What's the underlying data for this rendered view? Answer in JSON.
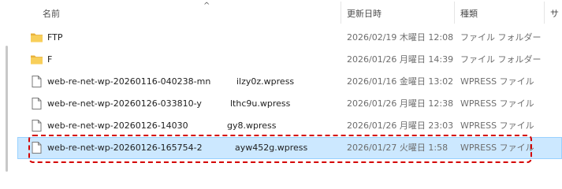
{
  "header": {
    "name_label": "名前",
    "sort_arrow": "^",
    "date_label": "更新日時",
    "type_label": "種類",
    "size_label": "サ"
  },
  "files": [
    {
      "name": "FTP",
      "modified": "2026/02/19 木曜日 12:08",
      "type": "ファイル フォルダー",
      "icon": "folder-icon",
      "selected": false
    },
    {
      "name": "F",
      "name_tail": "",
      "modified": "2026/01/26 月曜日 14:39",
      "type": "ファイル フォルダー",
      "icon": "folder-icon",
      "selected": false
    },
    {
      "name": "web-re-net-wp-20260116-040238-mn",
      "name_tail": "ilzy0z.wpress",
      "modified": "2026/01/16 金曜日 13:02",
      "type": "WPRESS ファイル",
      "icon": "document-icon",
      "selected": false
    },
    {
      "name": "web-re-net-wp-20260126-033810-y",
      "name_tail": "lthc9u.wpress",
      "modified": "2026/01/26 月曜日 12:38",
      "type": "WPRESS ファイル",
      "icon": "document-icon",
      "selected": false
    },
    {
      "name": "web-re-net-wp-20260126-140304-",
      "name_tail": "gy8.wpress",
      "modified": "2026/01/26 月曜日 23:03",
      "type": "WPRESS ファイル",
      "icon": "document-icon",
      "selected": false
    },
    {
      "name": "web-re-net-wp-20260126-165754-2",
      "name_tail": "ayw452g.wpress",
      "modified": "2026/01/27 火曜日 1:58",
      "type": "WPRESS ファイル",
      "icon": "document-icon",
      "selected": true
    }
  ],
  "colors": {
    "selection": "#cce8ff",
    "highlight_border": "#d40000",
    "folder": "#f4c44e"
  }
}
